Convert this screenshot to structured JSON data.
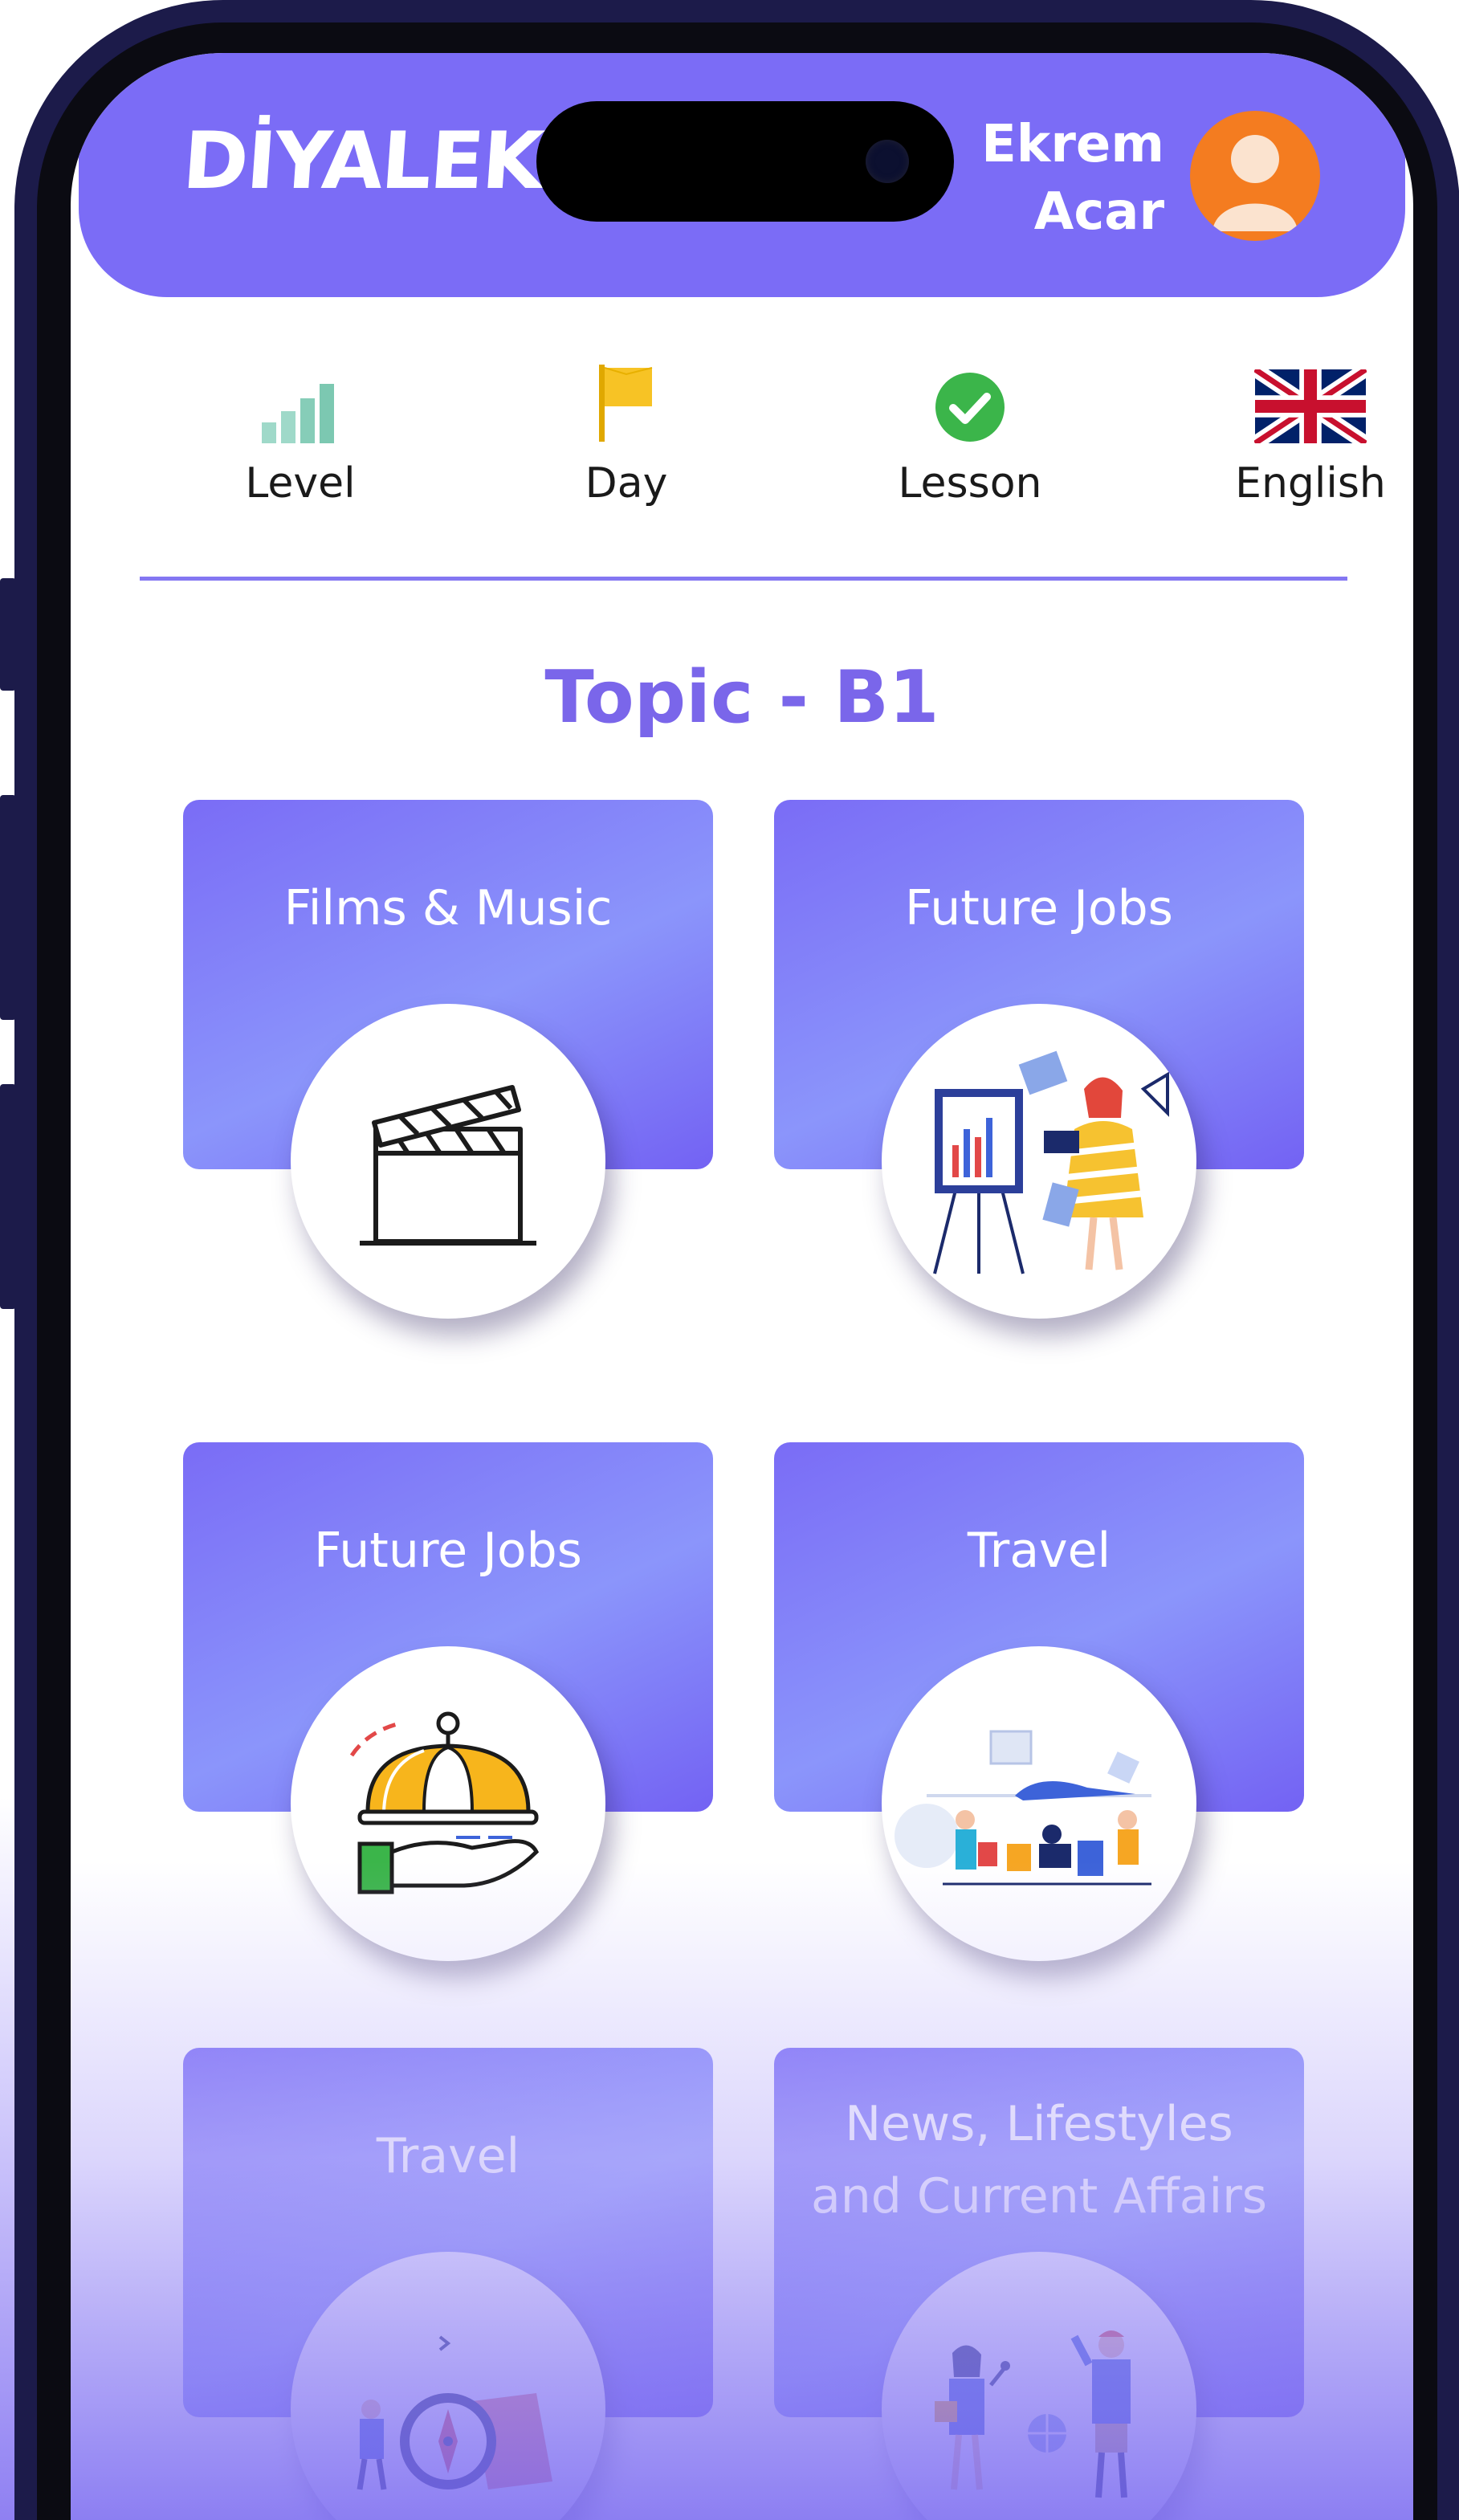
{
  "header": {
    "logo": "DİYALEKT",
    "user": {
      "first_name": "Ekrem",
      "last_name": "Acar"
    }
  },
  "stats": [
    {
      "label": "Level",
      "icon": "signal-bars-icon"
    },
    {
      "label": "Day",
      "icon": "flag-icon"
    },
    {
      "label": "Lesson",
      "icon": "check-circle-icon"
    },
    {
      "label": "English",
      "icon": "uk-flag-icon"
    }
  ],
  "page_title": "Topic - B1",
  "topics": [
    {
      "title": "Films & Music",
      "icon": "clapperboard-icon"
    },
    {
      "title": "Future Jobs",
      "icon": "presentation-icon"
    },
    {
      "title": "Future Jobs",
      "icon": "serving-cloche-icon"
    },
    {
      "title": "Travel",
      "icon": "airport-icon"
    },
    {
      "title": "Travel",
      "icon": "compass-map-icon"
    },
    {
      "title_line1": "News, Lifestyles",
      "title_line2": "and Current Affairs",
      "icon": "news-reporters-icon"
    }
  ],
  "colors": {
    "primary": "#7b6cf6",
    "title": "#7a66ea",
    "frame": "#1c1b4a",
    "avatar": "#f47c20"
  }
}
